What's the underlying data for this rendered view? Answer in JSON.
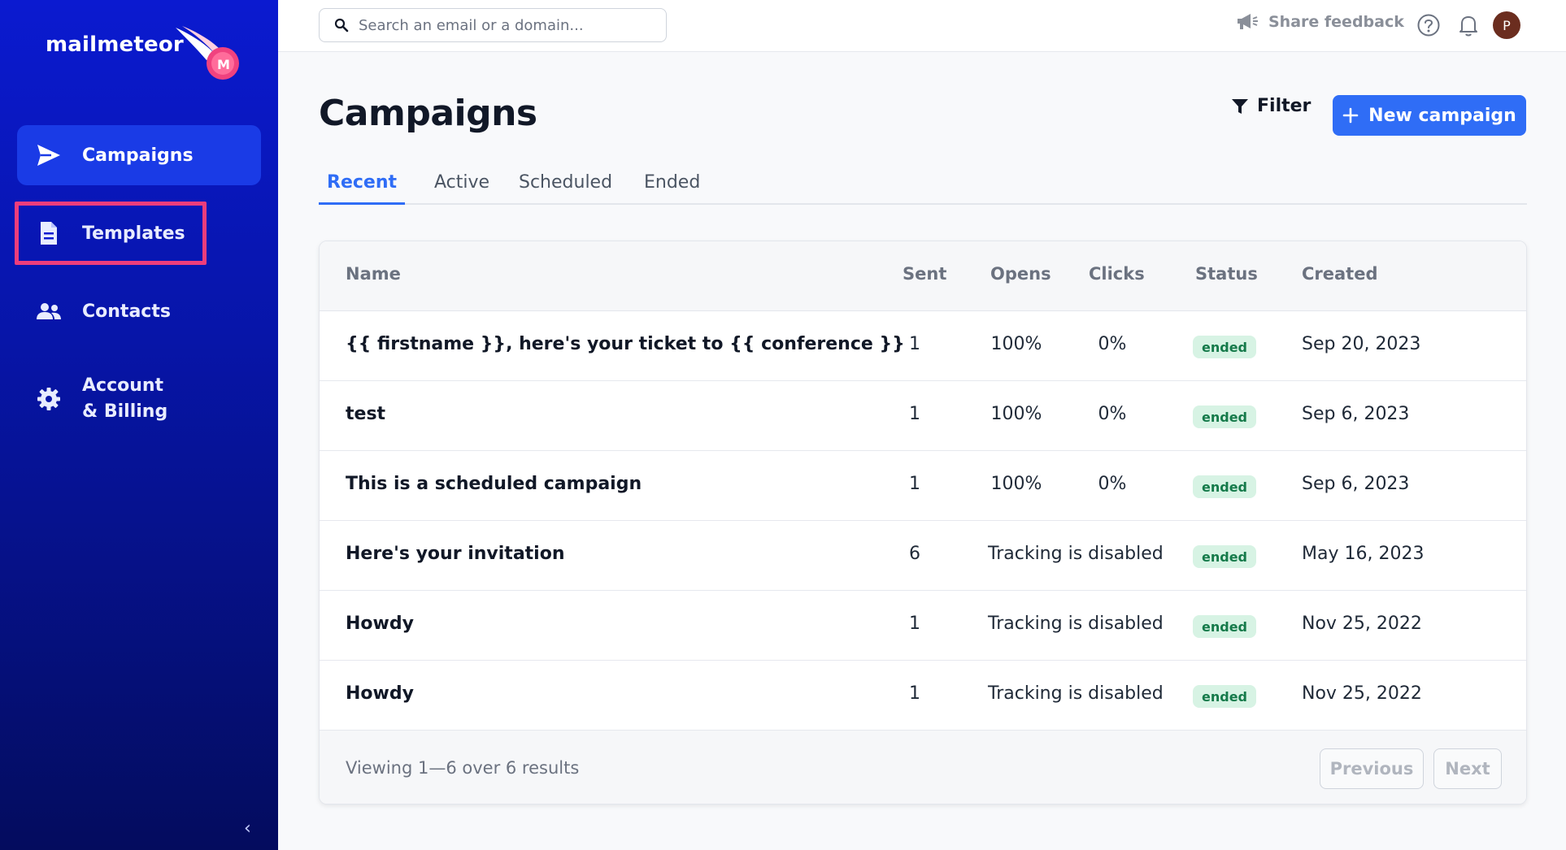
{
  "sidebar": {
    "logo_text": "mailmeteor",
    "items": [
      {
        "label": "Campaigns",
        "icon": "paper-plane-icon"
      },
      {
        "label": "Templates",
        "icon": "document-icon"
      },
      {
        "label": "Contacts",
        "icon": "users-icon"
      },
      {
        "label": "Account",
        "label2": "& Billing",
        "icon": "gear-icon"
      }
    ],
    "collapse_glyph": "‹",
    "highlight_color": "#ee3d7c"
  },
  "topbar": {
    "search_placeholder": "Search an email or a domain...",
    "feedback_label": "Share feedback",
    "avatar_initial": "P"
  },
  "main": {
    "title": "Campaigns",
    "filter_label": "Filter",
    "new_campaign_label": "New campaign",
    "tabs": [
      {
        "label": "Recent",
        "active": true
      },
      {
        "label": "Active",
        "active": false
      },
      {
        "label": "Scheduled",
        "active": false
      },
      {
        "label": "Ended",
        "active": false
      }
    ]
  },
  "table": {
    "columns": {
      "name": "Name",
      "sent": "Sent",
      "opens": "Opens",
      "clicks": "Clicks",
      "status": "Status",
      "created": "Created"
    },
    "rows": [
      {
        "name": "{{ firstname }}, here's your ticket to {{ conference }}",
        "sent": "1",
        "opens": "100%",
        "clicks": "0%",
        "tracking": "",
        "status": "ended",
        "created": "Sep 20, 2023"
      },
      {
        "name": "test",
        "sent": "1",
        "opens": "100%",
        "clicks": "0%",
        "tracking": "",
        "status": "ended",
        "created": "Sep 6, 2023"
      },
      {
        "name": "This is a scheduled campaign",
        "sent": "1",
        "opens": "100%",
        "clicks": "0%",
        "tracking": "",
        "status": "ended",
        "created": "Sep 6, 2023"
      },
      {
        "name": "Here's your invitation",
        "sent": "6",
        "opens": "",
        "clicks": "",
        "tracking": "Tracking is disabled",
        "status": "ended",
        "created": "May 16, 2023"
      },
      {
        "name": "Howdy",
        "sent": "1",
        "opens": "",
        "clicks": "",
        "tracking": "Tracking is disabled",
        "status": "ended",
        "created": "Nov 25, 2022"
      },
      {
        "name": "Howdy",
        "sent": "1",
        "opens": "",
        "clicks": "",
        "tracking": "Tracking is disabled",
        "status": "ended",
        "created": "Nov 25, 2022"
      }
    ],
    "footer": {
      "viewing": "Viewing 1—6 over 6 results",
      "previous": "Previous",
      "next": "Next"
    }
  },
  "colors": {
    "accent": "#2f6df6",
    "sidebar_top": "#0b1ad0",
    "sidebar_bottom": "#040c5e",
    "badge_bg": "#d7f3e4",
    "badge_text": "#157a4a"
  }
}
